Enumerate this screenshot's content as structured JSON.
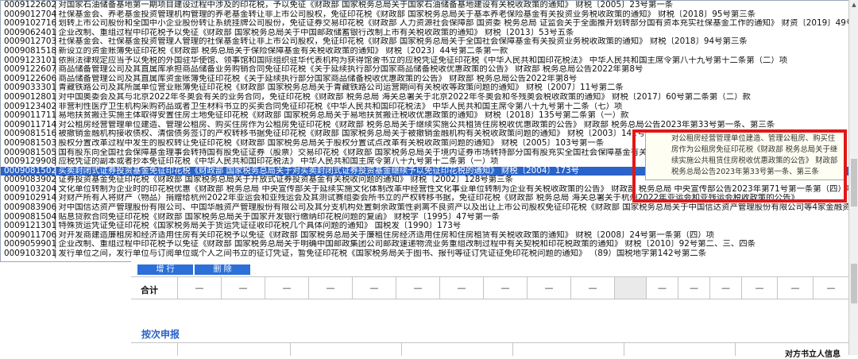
{
  "dropdown": {
    "selected_index": 18,
    "items": [
      {
        "code": "0009122602",
        "text": "对国家石油储备基地第一期项目建设过程中涉及的印花税，予以免征《财政部 国家税务总局关于国家石油储备基地建设有关税收政策的通知》 财税〔2005〕23号第一条"
      },
      {
        "code": "0009012704",
        "text": "社保基金会、养老基金投资管理机构管理的养老基金转让非上市公司股权，免征印花税《财政部 国家税务总局关于基本养老保险基金有关投资业务税收政策的通知》 财税〔2018〕95号第三条"
      },
      {
        "code": "0009102716",
        "text": "划转上市公司股份和全国中小企业股份转让系统挂牌公司股份，免征证券交易印花税《财政部 人力资源社会保障部 国资委 税务总局 证监会关于全面推开划转部分国有资本充实社保基金工作的通知》 财资〔2019〕49号"
      },
      {
        "code": "0009062401",
        "text": "企业改制、重组过程中印花税予以免征《财政部 国家税务总局关于中国邮政储蓄银行改制上市有关税收政策的通知》 财税〔2013〕53号五条"
      },
      {
        "code": "0009012703",
        "text": "社保基金会、社保基金投资管理人管理的社保基金转让非上市公司股权，免征印花税《财政部 国家税务总局关于全国社会保障基金有关投资业务税收政策的通知》 财税〔2018〕94号第三条"
      },
      {
        "code": "0009081518",
        "text": "新设立的资金账簿免征印花税《财政部 税务总局关于保险保障基金有关税收政策的通知》 财税〔2023〕44号第二条第一款"
      },
      {
        "code": "0009123101",
        "text": "依照法律规定应当予以免税的外国驻华使馆、领事馆和国际组织驻华代表机构为获得馆舍书立的应税凭证免征印花税《中华人民共和国印花税法》 中华人民共和国主席令第八十九号第十二条第（二）项"
      },
      {
        "code": "0009122607",
        "text": "商品储备管理公司及其直属库承担商品储备业务购销合同免征印花税《关于延续执行部分国家商品储备税收优惠政策的公告》 财政部 税务总局公告2022年第8号"
      },
      {
        "code": "0009122606",
        "text": "商品储备管理公司及其直属库资金账簿免征印花税《关于延续执行部分国家商品储备税收优惠政策的公告》 财政部 税务总局公告2022年第8号"
      },
      {
        "code": "0009033301",
        "text": "青藏铁路公司及其所属单位营业账簿免征印花税《财政部 国家税务总局关于青藏铁路公司运营期间有关税收等政策问题的通知》 财税〔2007〕11号第二条"
      },
      {
        "code": "0009012801",
        "text": "对中国奥委会及其与北京2022年冬奥会有关的业务合同，免征印花税《财政部 税务总局 海关总署关于北京2022年冬奥会和冬残奥会税收政策的通知》 财税〔2017〕60号第二条第（二）款"
      },
      {
        "code": "0009123402",
        "text": "非营利性医疗卫生机构采购药品或者卫生材料书立的买卖合同免征印花税《中华人民共和国印花税法》 中华人民共和国主席令第八十九号第十二条（七）项"
      },
      {
        "code": "0009011711",
        "text": "易地扶贫搬迁实施主体取得安置住房土地免征印花税《财政部 国家税务总局关于易地扶贫搬迁税收优惠政策的通知》 财税〔2018〕135号第二条第（一）款"
      },
      {
        "code": "0009011714",
        "text": "对公租房经营管理单位建造、管理公租房、购买住房作为公租房免征印花税《财政部 税务总局关于继续实施公共租赁住房税收优惠政策的公告》 财政部 税务总局公告2023年第33号第一条、第三条"
      },
      {
        "code": "0009081516",
        "text": "被撤销金融机构接收债权、清偿债务签订的产权转移书据免征印花税《财政部 国家税务总局关于被撤销金融机构有关税收政策问题的通知》 财税〔2003〕141号第二条第一款"
      },
      {
        "code": "0009081503",
        "text": "股权分置改革过程中发生的股权转让免征印花税《财政部 国家税务总局关于股权分置试点改革有关税收政策问题的通知》 财税〔2005〕103号第一条"
      },
      {
        "code": "0009081505",
        "text": "国有股东向全国社会保障基金理事会转持国有股免征证券（股票）交易印花税《财政部 国家税务总局关于境内证券市场转持部分国有股充实全国社会保障基金有关证券（股票）交易印花税政策的通知》"
      },
      {
        "code": "0009129908",
        "text": "应税凭证的副本或者抄本免征印花税《中华人民共和国印花税法》 中华人民共和国主席令第八十九号第十二条第（一）项"
      },
      {
        "code": "0009081502",
        "text": "买卖封闭式证券投资基金免征印花税《财政部 国家税务总局关于对买卖封闭式证券投资基金继续予以免征印花税的通知》 财税〔2004〕173号"
      },
      {
        "code": "0009083902",
        "text": "证券投资基金免征印花税《财政部 国家税务总局关于开放式证券投资基金有关税收问题的通知》 财税〔2002〕128号第三条"
      },
      {
        "code": "0009103204",
        "text": "文化单位转制为企业时的印花税优惠《财政部 税务总局 中央宣传部关于延续实施文化体制改革中经营性文化事业单位转制为企业有关税收政策的公告》 财政部 税务总局 中央宣传部公告2023年第71号第一条第（四）项"
      },
      {
        "code": "0009102914",
        "text": "对财产所有人将财产（物品）捐赠给杭州2022年亚运会和亚残运会及其测试赛组委会所书立的产权转移书据，免征印花税《财政部 税务总局 海关总署关于杭州2022年亚运会和亚残运会税收政策的公告》"
      },
      {
        "code": "0009083906",
        "text": "对中国信达资产管理股份有限公司、中国华融资产管理股份有限公司及其分支机构处置剩余政策性剥离不良资产以及出让上市公司股权免征印花税《财政部 国家税务总局关于中国信达资产管理股份有限公司等4家金融资产"
      },
      {
        "code": "0009081504",
        "text": "贴息贷款合同免征印花税《财政部 国家税务总局关于国家开发银行缴纳印花税问题的复函》 财税字〔1995〕47号第一条"
      },
      {
        "code": "0009121301",
        "text": "特殊货运凭证免征印花税《国家税务局关于货运凭证征收印花税几个具体问题的通知》 国税发〔1990〕173号"
      },
      {
        "code": "0009011706",
        "text": "对开发商建造廉租房和经济适用住房有关印花税予以免征《财政部 国家税务总局关于廉租住房经济适用住房和住房租赁有关税收政策的通知》 财税〔2008〕24号第一条第（四）项"
      },
      {
        "code": "0009059901",
        "text": "企业改制、重组过程中印花税予以免征《财政部 国家税务总局关于明确中国邮政集团公司邮政速递物流业务重组改制过程中有关契税和印花税政策的通知》 财税〔2010〕92号第二、三、四条"
      },
      {
        "code": "0009103201",
        "text": "发行单位之间，发行单位与订阅单位或个人之间书立的征订凭证，暂免征印花税《国家税务局关于图书、报刊等征订凭证征免印花税问题的通知》 （89）国税地字第142号第二条"
      }
    ]
  },
  "tooltip": {
    "text": "对公租房经营管理单位建造、管理公租房、购买住房作为公租房免征印花税《财政部 税务总局关于继续实施公共租赁住房税收优惠政策的公告》 财政部 税务总局公告2023年第33号第一条、第三条"
  },
  "form": {
    "add_label": "增 行",
    "delete_label": "删 除",
    "total_label": "合计",
    "dash": "—",
    "section_title": "按次申报",
    "corner_label": "对方书立人信息"
  },
  "colors": {
    "selection": "#2a63c9",
    "highlight_border": "#e01818",
    "button": "#2d6fd8",
    "section_title": "#2a62c9"
  }
}
